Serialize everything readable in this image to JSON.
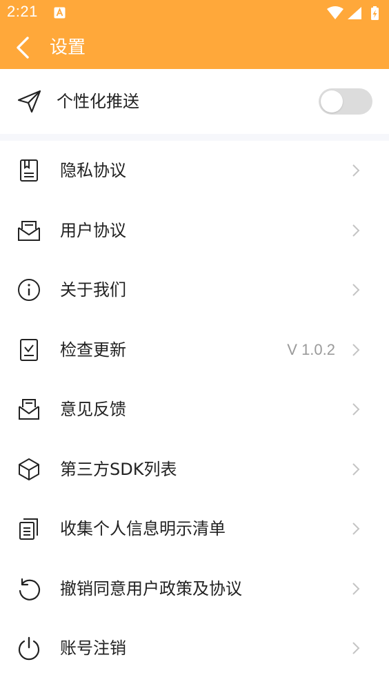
{
  "status_bar": {
    "time": "2:21",
    "notification_icon": "a-letter-icon",
    "wifi_icon": "wifi-icon",
    "signal_icon": "signal-icon",
    "battery_icon": "battery-charging-icon"
  },
  "app_bar": {
    "title": "设置",
    "back_icon": "chevron-left-icon"
  },
  "push_setting": {
    "label": "个性化推送",
    "icon": "send-icon",
    "toggle_on": false
  },
  "menu": {
    "items": [
      {
        "label": "隐私协议",
        "icon": "document-icon",
        "value": ""
      },
      {
        "label": "用户协议",
        "icon": "mail-open-icon",
        "value": ""
      },
      {
        "label": "关于我们",
        "icon": "info-icon",
        "value": ""
      },
      {
        "label": "检查更新",
        "icon": "update-check-icon",
        "value": "V 1.0.2"
      },
      {
        "label": "意见反馈",
        "icon": "feedback-icon",
        "value": ""
      },
      {
        "label": "第三方SDK列表",
        "icon": "cube-icon",
        "value": ""
      },
      {
        "label": "收集个人信息明示清单",
        "icon": "copy-list-icon",
        "value": ""
      },
      {
        "label": "撤销同意用户政策及协议",
        "icon": "undo-icon",
        "value": ""
      },
      {
        "label": "账号注销",
        "icon": "power-icon",
        "value": ""
      }
    ]
  },
  "colors": {
    "accent": "#ffa83a",
    "text": "#222222",
    "secondary_text": "#9a9a9a",
    "chevron": "#c4c4c4",
    "toggle_off": "#dcdcdc",
    "divider": "#f6f7fb"
  }
}
